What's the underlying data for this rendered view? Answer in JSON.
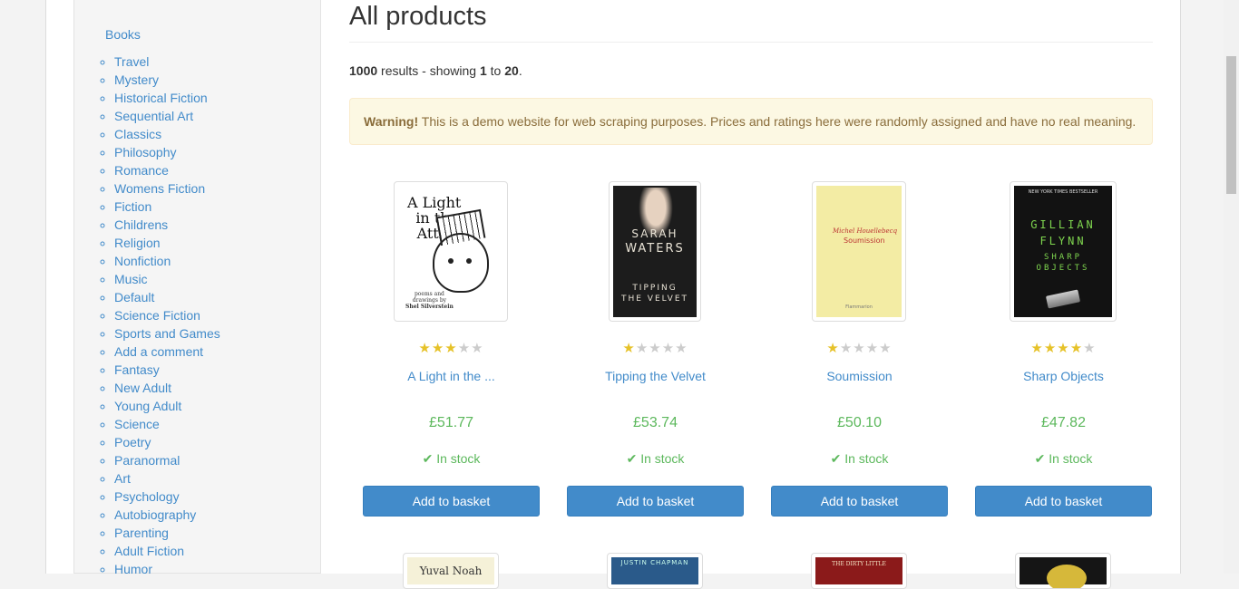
{
  "sidebar": {
    "top_category": "Books",
    "categories": [
      "Travel",
      "Mystery",
      "Historical Fiction",
      "Sequential Art",
      "Classics",
      "Philosophy",
      "Romance",
      "Womens Fiction",
      "Fiction",
      "Childrens",
      "Religion",
      "Nonfiction",
      "Music",
      "Default",
      "Science Fiction",
      "Sports and Games",
      "Add a comment",
      "Fantasy",
      "New Adult",
      "Young Adult",
      "Science",
      "Poetry",
      "Paranormal",
      "Art",
      "Psychology",
      "Autobiography",
      "Parenting",
      "Adult Fiction",
      "Humor"
    ]
  },
  "main": {
    "title": "All products",
    "results": {
      "count": "1000",
      "text_mid": " results - showing ",
      "from": "1",
      "to_word": " to ",
      "to": "20",
      "end": "."
    },
    "alert": {
      "strong": "Warning!",
      "text": " This is a demo website for web scraping purposes. Prices and ratings here were randomly assigned and have no real meaning."
    },
    "products": [
      {
        "title": "A Light in the ...",
        "price": "£51.77",
        "stock": "In stock",
        "rating": 3,
        "button": "Add to basket",
        "cover": {
          "t1": "A Light",
          "t2": "in the",
          "t3": "Attic",
          "sub1": "poems and",
          "sub2": "drawings by",
          "sub3": "Shel Silverstein"
        }
      },
      {
        "title": "Tipping the Velvet",
        "price": "£53.74",
        "stock": "In stock",
        "rating": 1,
        "button": "Add to basket",
        "cover": {
          "n1": "SARAH",
          "n2": "WATERS",
          "t1": "TIPPING",
          "t2": "THE VELVET"
        }
      },
      {
        "title": "Soumission",
        "price": "£50.10",
        "stock": "In stock",
        "rating": 1,
        "button": "Add to basket",
        "cover": {
          "author": "Michel Houellebecq",
          "title": "Soumission",
          "publisher": "Flammarion"
        }
      },
      {
        "title": "Sharp Objects",
        "price": "£47.82",
        "stock": "In stock",
        "rating": 4,
        "button": "Add to basket",
        "cover": {
          "top": "NEW YORK TIMES BESTSELLER",
          "g1": "GILLIAN",
          "g2": "FLYNN",
          "g3": "SHARP",
          "g4": "OBJECTS"
        }
      }
    ],
    "second_row_covers": [
      {
        "text": "Yuval Noah"
      },
      {
        "text": "JUSTIN CHAPMAN"
      },
      {
        "text": "THE DIRTY LITTLE"
      },
      {
        "text": ""
      }
    ]
  },
  "colors": {
    "link": "#428bca",
    "price": "#5cb85c",
    "button": "#428bca",
    "star_on": "#e6c229",
    "star_off": "#cccccc",
    "alert_bg": "#fcf8e3",
    "alert_text": "#8a6d3b"
  },
  "icons": {
    "stock": "check-icon",
    "rating": "star-icon"
  }
}
